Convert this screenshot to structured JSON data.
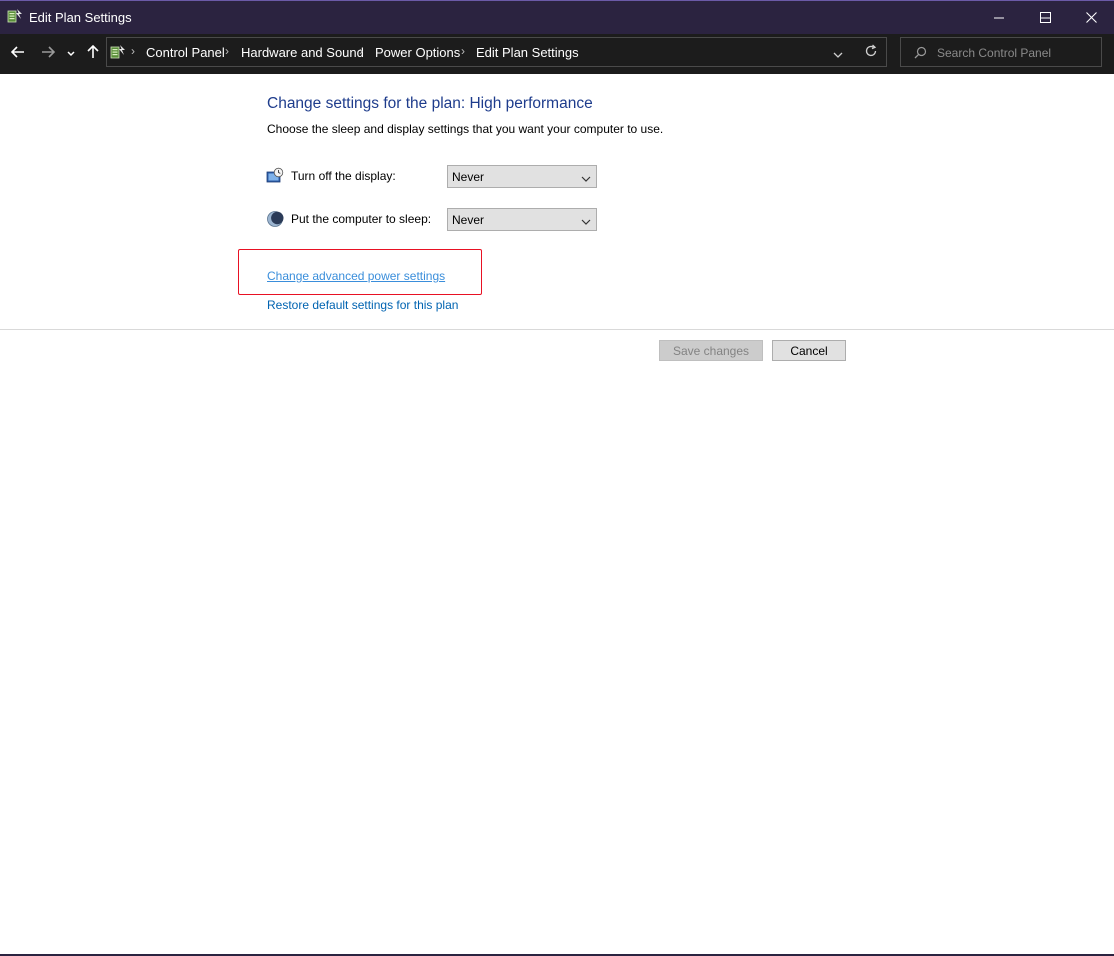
{
  "window": {
    "title": "Edit Plan Settings",
    "titlebar_color": "#2b2340"
  },
  "controls": {
    "minimize_icon": "minimize-icon",
    "maximize_icon": "maximize-icon",
    "close_icon": "close-icon"
  },
  "address_bar": {
    "breadcrumbs": [
      "Control Panel",
      "Hardware and Sound",
      "Power Options",
      "Edit Plan Settings"
    ],
    "search_placeholder": "Search Control Panel"
  },
  "main": {
    "heading": "Change settings for the plan: High performance",
    "subtext": "Choose the sleep and display settings that you want your computer to use.",
    "settings": [
      {
        "label": "Turn off the display:",
        "value": "Never",
        "icon": "display-timer-icon"
      },
      {
        "label": "Put the computer to sleep:",
        "value": "Never",
        "icon": "sleep-moon-icon"
      }
    ],
    "links": {
      "advanced": "Change advanced power settings",
      "restore": "Restore default settings for this plan"
    },
    "buttons": {
      "save": "Save changes",
      "cancel": "Cancel"
    },
    "colors": {
      "heading": "#1e3c8c",
      "link": "#0063b1",
      "highlight_box": "#e81123"
    }
  }
}
